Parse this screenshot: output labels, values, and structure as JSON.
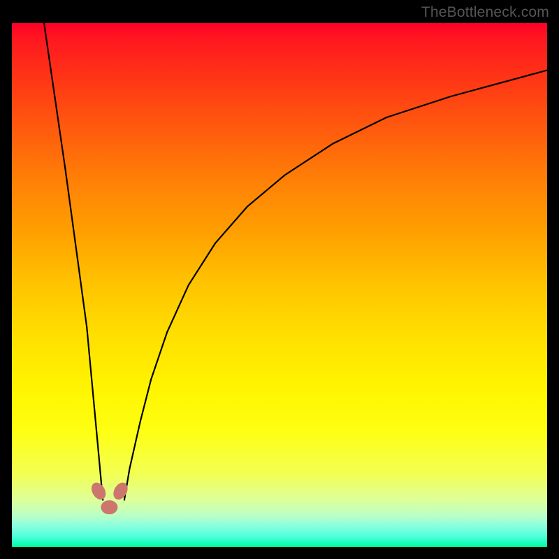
{
  "watermark": {
    "text": "TheBottleneck.com"
  },
  "colors": {
    "background": "#000000",
    "curve": "#000000",
    "bean": "#cc766d",
    "gradient_top": "#ff0026",
    "gradient_bottom": "#00ff98"
  },
  "plot": {
    "x_range": [
      0,
      100
    ],
    "y_range": [
      0,
      100
    ],
    "y_axis_inverted": true
  },
  "chart_data": {
    "type": "line",
    "title": "",
    "xlabel": "",
    "ylabel": "",
    "xlim": [
      0,
      100
    ],
    "ylim": [
      0,
      100
    ],
    "series": [
      {
        "name": "left-branch",
        "x": [
          6,
          8,
          10,
          12,
          14,
          15,
          16,
          17
        ],
        "values": [
          0,
          14,
          28,
          43,
          58,
          69,
          80,
          91
        ]
      },
      {
        "name": "right-branch",
        "x": [
          21,
          22,
          24,
          26,
          29,
          33,
          38,
          44,
          51,
          60,
          70,
          82,
          100
        ],
        "values": [
          91,
          85,
          76,
          68,
          59,
          50,
          42,
          35,
          29,
          23,
          18,
          14,
          9
        ]
      }
    ],
    "markers": [
      {
        "name": "bean-left",
        "x": 16.2,
        "y": 89.3
      },
      {
        "name": "bean-right",
        "x": 20.3,
        "y": 89.3
      },
      {
        "name": "bean-bottom",
        "x": 18.2,
        "y": 92.4
      }
    ]
  }
}
